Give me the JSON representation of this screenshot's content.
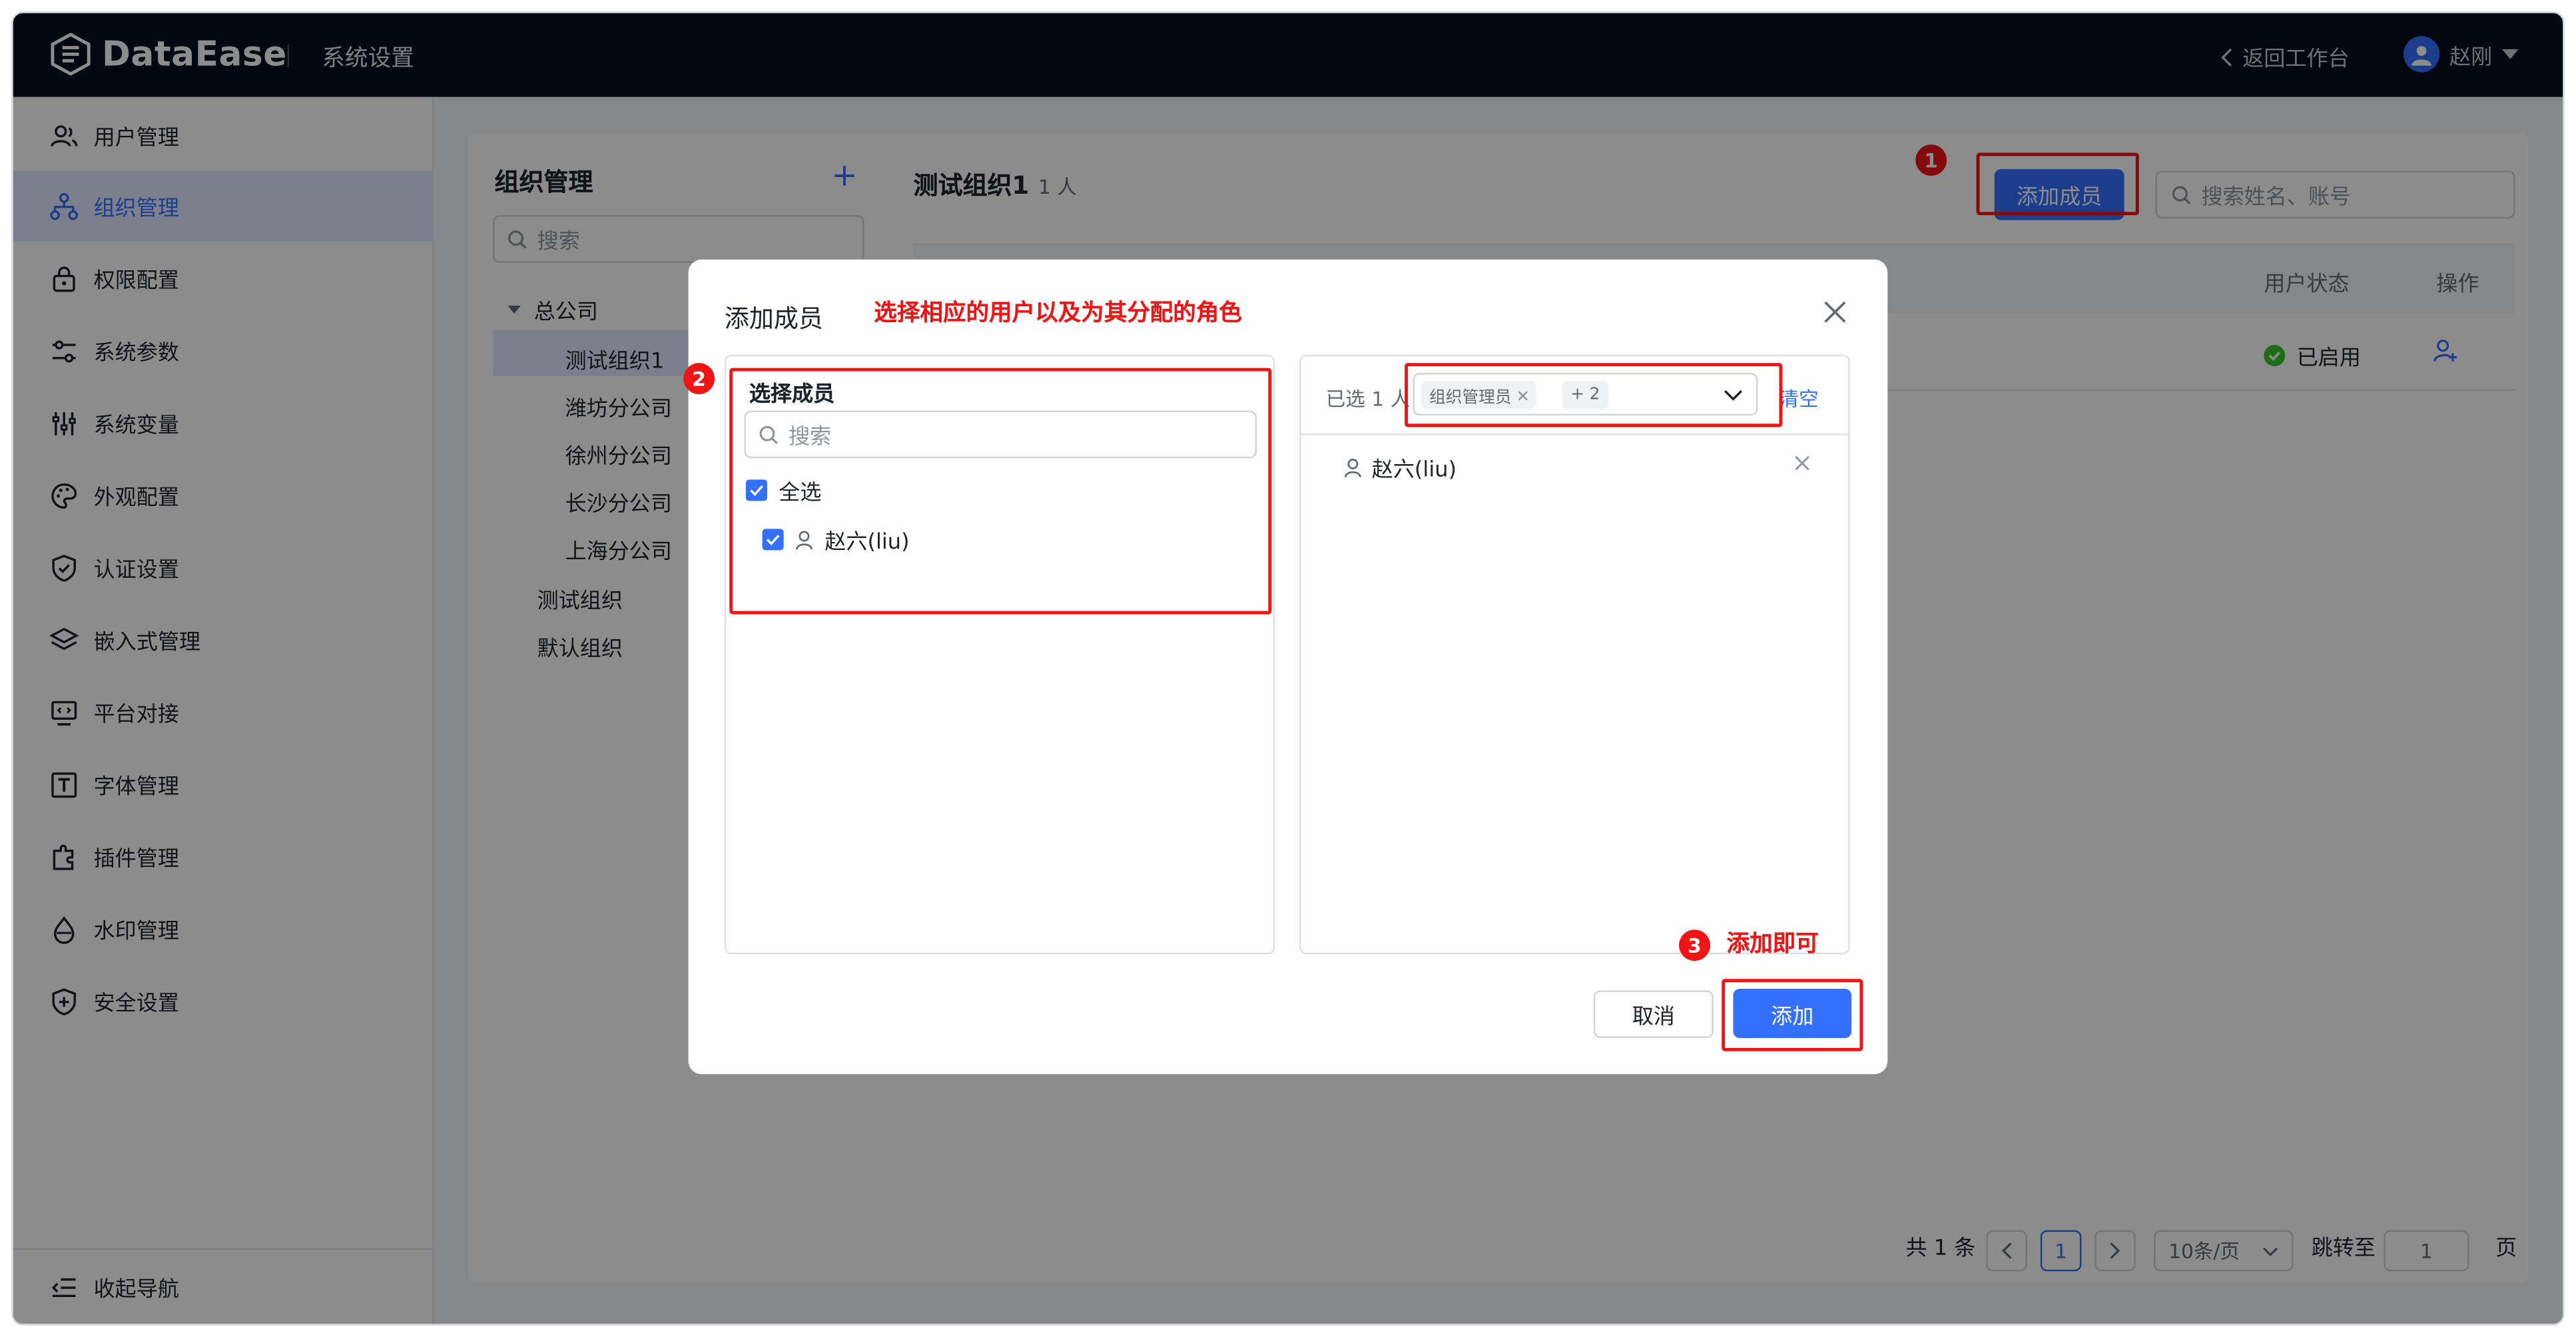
{
  "app": {
    "name": "DataEase",
    "section": "系统设置"
  },
  "topbar": {
    "back_label": "返回工作台",
    "user_name": "赵刚"
  },
  "sidebar": {
    "items": [
      {
        "label": "用户管理",
        "icon": "users-icon"
      },
      {
        "label": "组织管理",
        "icon": "org-tree-icon",
        "active": true
      },
      {
        "label": "权限配置",
        "icon": "lock-icon"
      },
      {
        "label": "系统参数",
        "icon": "sliders-icon"
      },
      {
        "label": "系统变量",
        "icon": "variable-icon"
      },
      {
        "label": "外观配置",
        "icon": "palette-icon"
      },
      {
        "label": "认证设置",
        "icon": "shield-check-icon"
      },
      {
        "label": "嵌入式管理",
        "icon": "layers-icon"
      },
      {
        "label": "平台对接",
        "icon": "monitor-code-icon"
      },
      {
        "label": "字体管理",
        "icon": "font-icon"
      },
      {
        "label": "插件管理",
        "icon": "plugin-icon"
      },
      {
        "label": "水印管理",
        "icon": "droplet-icon"
      },
      {
        "label": "安全设置",
        "icon": "shield-plus-icon"
      }
    ],
    "collapse_label": "收起导航"
  },
  "org_panel": {
    "title": "组织管理",
    "search_placeholder": "搜索",
    "tree": [
      {
        "label": "总公司",
        "level": 0,
        "expanded": true
      },
      {
        "label": "测试组织1",
        "level": 1,
        "selected": true
      },
      {
        "label": "潍坊分公司",
        "level": 1
      },
      {
        "label": "徐州分公司",
        "level": 1
      },
      {
        "label": "长沙分公司",
        "level": 1
      },
      {
        "label": "上海分公司",
        "level": 1
      },
      {
        "label": "测试组织",
        "level": 0
      },
      {
        "label": "默认组织",
        "level": 0
      }
    ]
  },
  "group": {
    "title": "测试组织1",
    "count": "1 人",
    "add_member_label": "添加成员",
    "search_placeholder": "搜索姓名、账号",
    "columns": [
      "用户状态",
      "操作"
    ],
    "row": {
      "status": "已启用"
    }
  },
  "pagination": {
    "total": "共 1 条",
    "current": "1",
    "page_size": "10条/页",
    "jump_label": "跳转至",
    "jump_value": "1",
    "page_unit": "页"
  },
  "dialog": {
    "title": "添加成员",
    "note": "选择相应的用户以及为其分配的角色",
    "left": {
      "title": "选择成员",
      "search_placeholder": "搜索",
      "select_all": "全选",
      "users": [
        "赵六(liu)"
      ]
    },
    "right": {
      "selected_count": "已选 1 人",
      "role_tag": "组织管理员",
      "more_tag": "+ 2",
      "clear_label": "清空",
      "selected_users": [
        "赵六(liu)"
      ]
    },
    "cancel_label": "取消",
    "confirm_label": "添加"
  },
  "annotations": {
    "step1": "1",
    "step2": "2",
    "step3": "3",
    "step3_text": "添加即可",
    "color": "#f01414"
  }
}
